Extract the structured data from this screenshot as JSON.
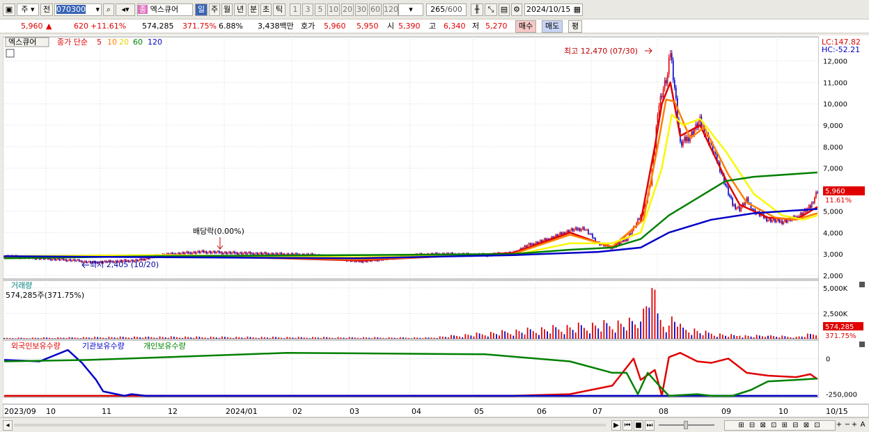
{
  "toolbar": {
    "market": "주",
    "prev": "전",
    "code": "070300",
    "type_badge": "종",
    "name": "엑스큐어",
    "periods": [
      "일",
      "주",
      "월",
      "년",
      "분",
      "초",
      "틱"
    ],
    "active_period": "일",
    "intervals": [
      "1",
      "3",
      "5",
      "10",
      "20",
      "30",
      "60",
      "120"
    ],
    "count": "265",
    "count_max": "/600",
    "date": "2024/10/15"
  },
  "quote": {
    "price": "5,960",
    "change": "620",
    "change_pct": "+11.61%",
    "volume": "574,285",
    "volume_ratio": "371.75%",
    "turnover": "6.88%",
    "amount": "3,438백만",
    "bid_label": "호가",
    "ask": "5,960",
    "bid": "5,950",
    "open_label": "시",
    "open": "5,390",
    "high_label": "고",
    "high": "6,340",
    "low_label": "저",
    "low": "5,270",
    "buy_button": "매수",
    "sell_button": "매도",
    "eval_button": "평"
  },
  "price_panel": {
    "stock_label": "엑스큐어",
    "ma_label": "종가 단순",
    "ma_periods": [
      "5",
      "10",
      "20",
      "60",
      "120"
    ],
    "lc": "LC:147.82",
    "hc": "HC:-52.21",
    "max_label": "최고 12,470 (07/30)",
    "min_label": "최저 2,405 (10/20)",
    "dividend_label": "배당락(0.00%)",
    "last_price_tag": "5,960",
    "last_change_tag": "11.61%"
  },
  "volume_panel": {
    "title": "거래량",
    "value": "574,285주(371.75%)",
    "last_tag": "574,285",
    "last_ratio_tag": "371.75%"
  },
  "holding_panel": {
    "foreign": "외국인보유수량",
    "institution": "기관보유수량",
    "individual": "개인보유수량"
  },
  "chart_data": {
    "type": "line",
    "price_axis": {
      "ticks": [
        2000,
        3000,
        4000,
        5000,
        6000,
        7000,
        8000,
        9000,
        10000,
        11000,
        12000
      ],
      "tick_labels": [
        "2,000",
        "3,000",
        "4,000",
        "5,000",
        "6,000",
        "7,000",
        "8,000",
        "9,000",
        "10,000",
        "11,000",
        "12,000"
      ]
    },
    "volume_axis": {
      "ticks": [
        2500000,
        5000000
      ],
      "tick_labels": [
        "2,500K",
        "5,000K"
      ]
    },
    "holding_axis": {
      "ticks": [
        0,
        -250000
      ],
      "tick_labels": [
        "0",
        "-250,000"
      ]
    },
    "x_labels": [
      "2023/09",
      "10",
      "11",
      "12",
      "2024/01",
      "02",
      "03",
      "04",
      "05",
      "06",
      "07",
      "08",
      "09",
      "10",
      "10/15"
    ],
    "price_series_points": [
      [
        0,
        2900
      ],
      [
        25,
        2800
      ],
      [
        50,
        2700
      ],
      [
        62,
        2600
      ],
      [
        75,
        2650
      ],
      [
        95,
        2700
      ],
      [
        110,
        2950
      ],
      [
        140,
        3100
      ],
      [
        160,
        3050
      ],
      [
        190,
        3000
      ],
      [
        220,
        2950
      ],
      [
        250,
        2650
      ],
      [
        260,
        2700
      ],
      [
        290,
        2950
      ],
      [
        310,
        3000
      ],
      [
        340,
        2950
      ],
      [
        360,
        3050
      ],
      [
        370,
        3400
      ],
      [
        385,
        3700
      ],
      [
        400,
        4100
      ],
      [
        410,
        4200
      ],
      [
        420,
        3500
      ],
      [
        430,
        3300
      ],
      [
        440,
        3700
      ],
      [
        445,
        4200
      ],
      [
        452,
        5000
      ],
      [
        457,
        6300
      ],
      [
        460,
        8000
      ],
      [
        462,
        9700
      ],
      [
        465,
        10500
      ],
      [
        469,
        11300
      ],
      [
        471,
        12470
      ],
      [
        474,
        10800
      ],
      [
        478,
        8100
      ],
      [
        485,
        8500
      ],
      [
        492,
        9200
      ],
      [
        500,
        8000
      ],
      [
        505,
        7200
      ],
      [
        510,
        6200
      ],
      [
        515,
        5300
      ],
      [
        520,
        5100
      ],
      [
        525,
        5500
      ],
      [
        530,
        5000
      ],
      [
        540,
        4600
      ],
      [
        550,
        4500
      ],
      [
        560,
        4700
      ],
      [
        570,
        5200
      ],
      [
        575,
        5960
      ]
    ],
    "ma_series": [
      {
        "name": "5",
        "color": "#e00000",
        "points": [
          [
            0,
            2800
          ],
          [
            110,
            2950
          ],
          [
            250,
            2700
          ],
          [
            360,
            3050
          ],
          [
            400,
            4000
          ],
          [
            430,
            3300
          ],
          [
            450,
            4500
          ],
          [
            460,
            8000
          ],
          [
            465,
            10000
          ],
          [
            471,
            11000
          ],
          [
            478,
            8500
          ],
          [
            492,
            9000
          ],
          [
            510,
            6500
          ],
          [
            520,
            5300
          ],
          [
            540,
            4700
          ],
          [
            560,
            4600
          ],
          [
            575,
            5200
          ]
        ]
      },
      {
        "name": "10",
        "color": "#ff8000",
        "points": [
          [
            0,
            2850
          ],
          [
            110,
            2900
          ],
          [
            250,
            2750
          ],
          [
            360,
            3000
          ],
          [
            400,
            3900
          ],
          [
            430,
            3350
          ],
          [
            452,
            4600
          ],
          [
            462,
            8000
          ],
          [
            468,
            10200
          ],
          [
            474,
            10100
          ],
          [
            485,
            8400
          ],
          [
            495,
            8900
          ],
          [
            512,
            6700
          ],
          [
            525,
            5400
          ],
          [
            545,
            4700
          ],
          [
            560,
            4600
          ],
          [
            575,
            4900
          ]
        ]
      },
      {
        "name": "20",
        "color": "#f8f800",
        "points": [
          [
            0,
            2900
          ],
          [
            110,
            2950
          ],
          [
            250,
            2850
          ],
          [
            360,
            2950
          ],
          [
            400,
            3500
          ],
          [
            430,
            3500
          ],
          [
            450,
            4000
          ],
          [
            465,
            7000
          ],
          [
            472,
            9500
          ],
          [
            480,
            9000
          ],
          [
            492,
            9300
          ],
          [
            510,
            7800
          ],
          [
            530,
            5800
          ],
          [
            550,
            4800
          ],
          [
            565,
            4600
          ],
          [
            575,
            4800
          ]
        ]
      },
      {
        "name": "60",
        "color": "#008000",
        "points": [
          [
            0,
            2800
          ],
          [
            110,
            2900
          ],
          [
            250,
            2950
          ],
          [
            360,
            3000
          ],
          [
            400,
            3200
          ],
          [
            430,
            3300
          ],
          [
            450,
            3700
          ],
          [
            470,
            4800
          ],
          [
            490,
            5600
          ],
          [
            510,
            6400
          ],
          [
            530,
            6600
          ],
          [
            575,
            6800
          ]
        ]
      },
      {
        "name": "120",
        "color": "#0000c8",
        "points": [
          [
            0,
            2900
          ],
          [
            110,
            2850
          ],
          [
            250,
            2800
          ],
          [
            360,
            2950
          ],
          [
            420,
            3100
          ],
          [
            450,
            3300
          ],
          [
            470,
            4000
          ],
          [
            500,
            4600
          ],
          [
            530,
            4900
          ],
          [
            575,
            5100
          ]
        ]
      }
    ],
    "volume_bars": [
      [
        0,
        80000
      ],
      [
        100,
        200000
      ],
      [
        300,
        120000
      ],
      [
        450,
        1700000
      ],
      [
        458,
        5000000
      ],
      [
        462,
        2500000
      ],
      [
        470,
        1300000
      ],
      [
        473,
        2800000
      ],
      [
        476,
        1200000
      ],
      [
        480,
        1100000
      ],
      [
        500,
        500000
      ],
      [
        520,
        300000
      ],
      [
        540,
        300000
      ],
      [
        560,
        200000
      ],
      [
        575,
        574285
      ]
    ],
    "holding_series": [
      {
        "name": "외국인보유수량",
        "color": "#e00000",
        "points": [
          [
            0,
            -280000
          ],
          [
            80,
            -300000
          ],
          [
            200,
            -310000
          ],
          [
            360,
            -305000
          ],
          [
            400,
            -250000
          ],
          [
            430,
            -190000
          ],
          [
            445,
            0
          ],
          [
            450,
            -150000
          ],
          [
            460,
            -80000
          ],
          [
            465,
            -260000
          ],
          [
            470,
            10000
          ],
          [
            478,
            40000
          ],
          [
            490,
            -20000
          ],
          [
            500,
            -30000
          ],
          [
            512,
            0
          ],
          [
            525,
            -100000
          ],
          [
            540,
            -120000
          ],
          [
            560,
            -130000
          ],
          [
            570,
            -110000
          ],
          [
            575,
            -145000
          ]
        ]
      },
      {
        "name": "기관보유수량",
        "color": "#0000c8",
        "points": [
          [
            0,
            -10000
          ],
          [
            25,
            -20000
          ],
          [
            45,
            60000
          ],
          [
            55,
            -30000
          ],
          [
            65,
            -150000
          ],
          [
            70,
            -230000
          ],
          [
            85,
            -300000
          ],
          [
            90,
            -250000
          ],
          [
            100,
            -310000
          ],
          [
            150,
            -310000
          ],
          [
            360,
            -310000
          ],
          [
            575,
            -300000
          ]
        ]
      },
      {
        "name": "개인보유수량",
        "color": "#008000",
        "points": [
          [
            0,
            -20000
          ],
          [
            60,
            -10000
          ],
          [
            200,
            40000
          ],
          [
            340,
            30000
          ],
          [
            400,
            -20000
          ],
          [
            430,
            -100000
          ],
          [
            440,
            -100000
          ],
          [
            448,
            -250000
          ],
          [
            455,
            -100000
          ],
          [
            465,
            -210000
          ],
          [
            470,
            -310000
          ],
          [
            490,
            -250000
          ],
          [
            500,
            -300000
          ],
          [
            515,
            -300000
          ],
          [
            528,
            -220000
          ],
          [
            540,
            -160000
          ],
          [
            560,
            -150000
          ],
          [
            575,
            -140000
          ]
        ]
      }
    ]
  },
  "bottom": {
    "nav": [
      "▶",
      "⏮",
      "■",
      "⏭"
    ],
    "tools": [
      "+",
      "−",
      "+",
      "A"
    ]
  },
  "colors": {
    "up": "#e00000",
    "down": "#0000c8",
    "accent": "#3a64b4",
    "yellow": "#f8f800",
    "orange": "#ff8000",
    "green": "#008000"
  }
}
